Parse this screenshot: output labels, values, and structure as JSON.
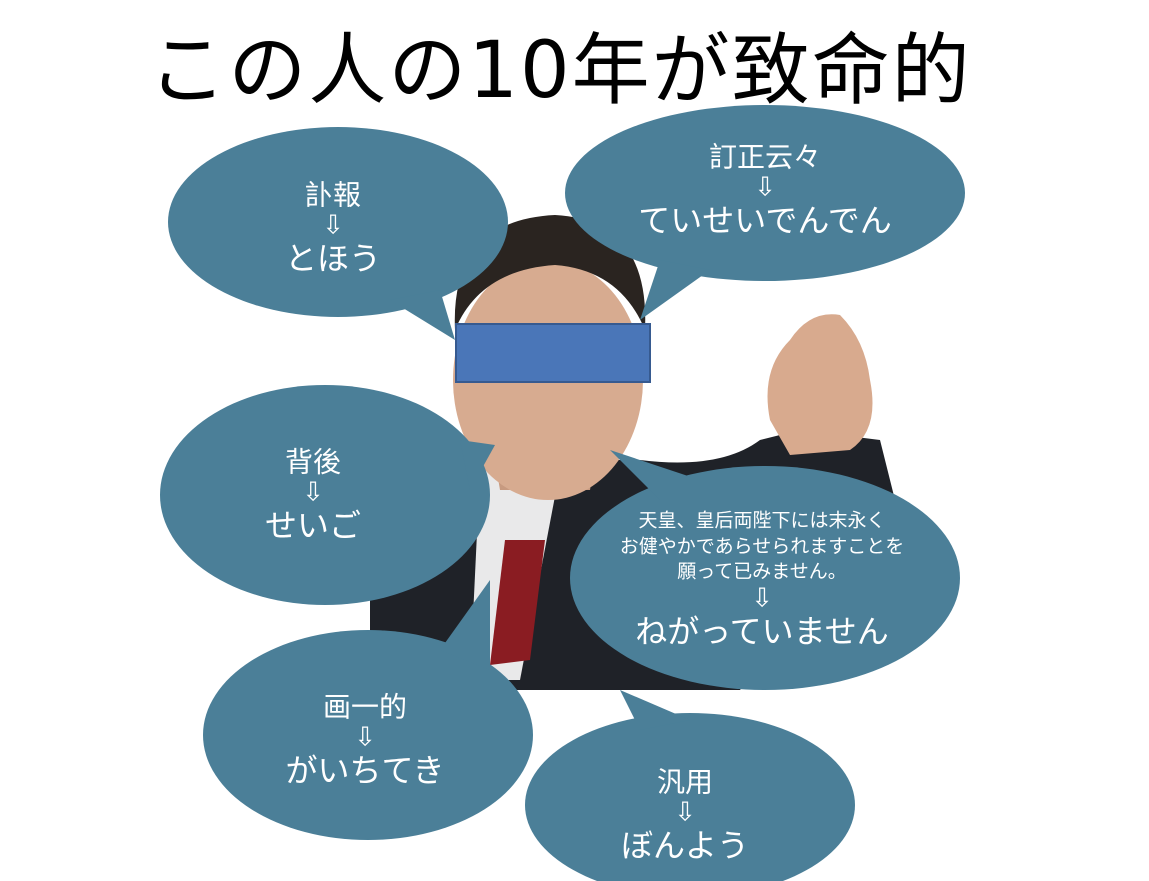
{
  "title": "この人の10年が致命的",
  "bubble_color": "#4b7f98",
  "censor_color": "#4a76b8",
  "bubbles": [
    {
      "source": "訃報",
      "arrow": "⇩",
      "reading": "とほう"
    },
    {
      "source": "訂正云々",
      "arrow": "⇩",
      "reading": "ていせいでんでん"
    },
    {
      "source": "背後",
      "arrow": "⇩",
      "reading": "せいご"
    },
    {
      "source_lines": [
        "天皇、皇后両陛下には末永く",
        "お健やかであらせられますことを",
        "願って已みません。"
      ],
      "arrow": "⇩",
      "reading": "ねがっていません"
    },
    {
      "source": "画一的",
      "arrow": "⇩",
      "reading": "がいちてき"
    },
    {
      "source": "汎用",
      "arrow": "⇩",
      "reading": "ぼんよう"
    }
  ]
}
